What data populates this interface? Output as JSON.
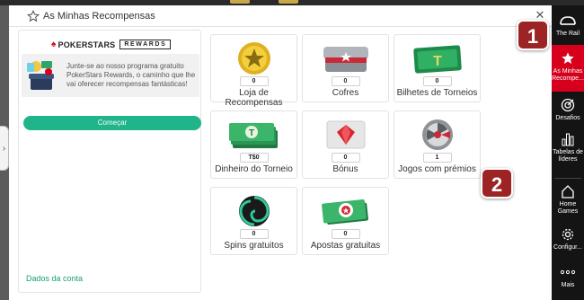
{
  "window": {
    "title": "As Minhas Recompensas"
  },
  "left_panel": {
    "brand": "POKERSTARS",
    "rewards_badge": "REWARDS",
    "promo_text": "Junte-se ao nosso programa gratuito PokerStars Rewards, o caminho que lhe vai oferecer recompensas fantásticas!",
    "start_button": "Começar",
    "account_link": "Dados da conta"
  },
  "tiles": [
    {
      "label": "Loja de Recompensas",
      "count": "0"
    },
    {
      "label": "Cofres",
      "count": "0"
    },
    {
      "label": "Bilhetes de Torneios",
      "count": "0"
    },
    {
      "label": "Dinheiro do Torneio",
      "count": "T$0"
    },
    {
      "label": "Bónus",
      "count": "0"
    },
    {
      "label": "Jogos com prémios",
      "count": "1"
    },
    {
      "label": "Spins gratuitos",
      "count": "0"
    },
    {
      "label": "Apostas gratuitas",
      "count": "0"
    }
  ],
  "badges": {
    "first": "1",
    "second": "2"
  },
  "sidebar": {
    "items": [
      {
        "label": "The Rail",
        "icon": "rail-icon"
      },
      {
        "label": "As Minhas Recompe...",
        "icon": "star-icon"
      },
      {
        "label": "Desafios",
        "icon": "target-icon"
      },
      {
        "label": "Tabelas de líderes",
        "icon": "bar-chart-icon"
      },
      {
        "label": "Home Games",
        "icon": "home-icon"
      },
      {
        "label": "Configur...",
        "icon": "gear-icon"
      },
      {
        "label": "Mais",
        "icon": "more-icon"
      }
    ]
  },
  "colors": {
    "accent_green": "#1fb48a",
    "brand_red": "#d6001c",
    "badge_red": "#9c2424",
    "sidebar_bg": "#141414"
  }
}
